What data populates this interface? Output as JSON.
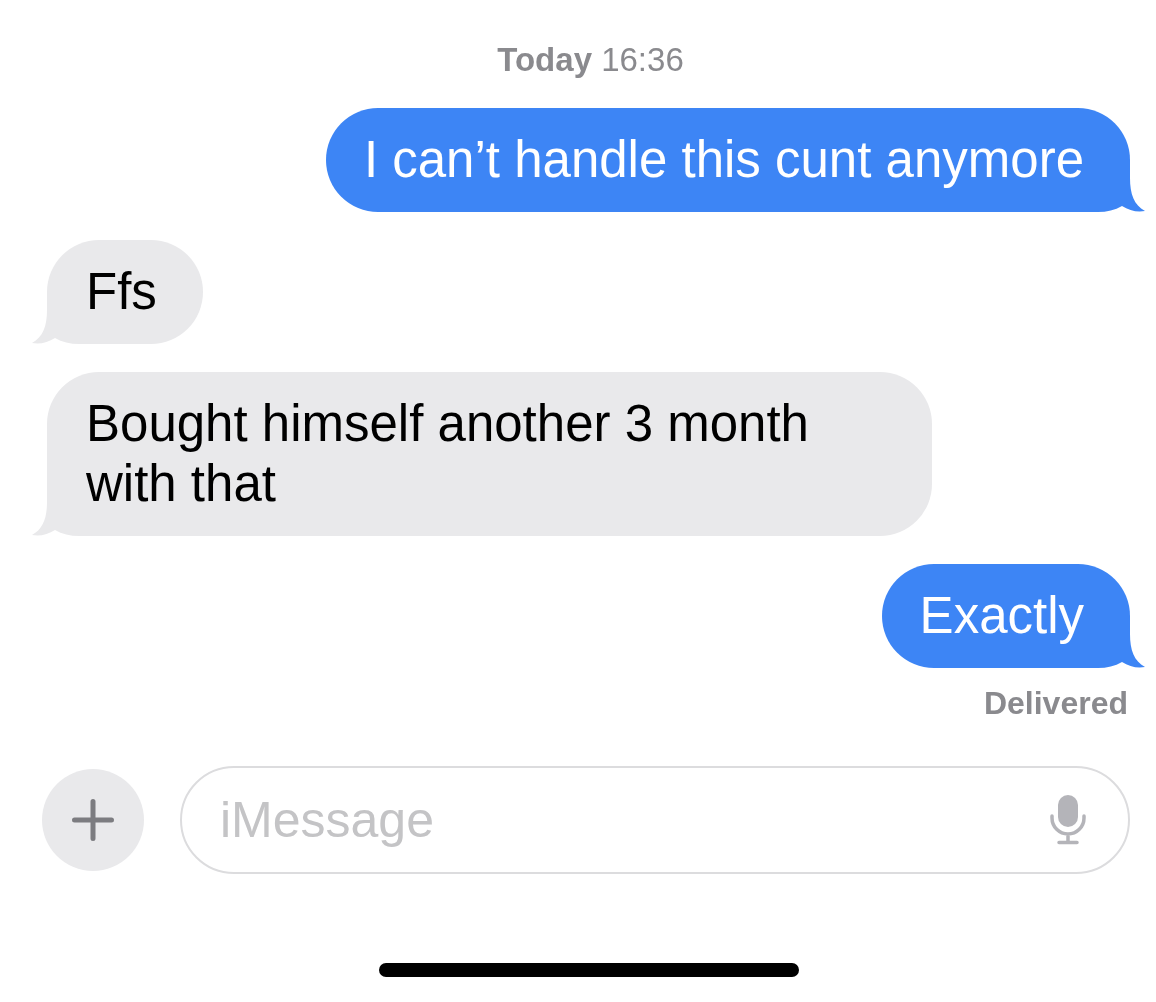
{
  "timestamp": "**Today** 16:36",
  "messages": [
    {
      "kind": "sent",
      "text": "I can’t handle this cunt anymore"
    },
    {
      "kind": "received",
      "text": "Ffs"
    },
    {
      "kind": "received",
      "text": "Bought himself another 3 month with that"
    },
    {
      "kind": "sent",
      "text": "Exactly",
      "receipt": "Delivered"
    }
  ],
  "composer": {
    "placeholder": "iMessage"
  }
}
